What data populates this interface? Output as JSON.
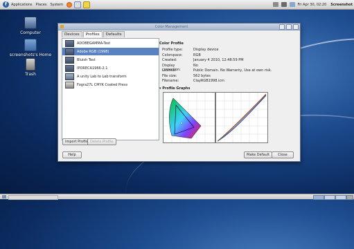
{
  "panel": {
    "menus": [
      "Applications",
      "Places",
      "System"
    ],
    "clock": "Fri Apr 30, 02:20",
    "screenshot_label": "Screenshot"
  },
  "desktop_icons": [
    {
      "label": "Computer",
      "icon": "computer-icon"
    },
    {
      "label": "screenshots's Home",
      "icon": "home-folder-icon"
    },
    {
      "label": "Trash",
      "icon": "trash-icon"
    }
  ],
  "window": {
    "title": "Color Management",
    "tabs": [
      "Devices",
      "Profiles",
      "Defaults"
    ],
    "active_tab": "Profiles",
    "profiles": [
      {
        "name": "ADOBEGAMMA-Test",
        "icon": "display-profile-icon"
      },
      {
        "name": "Adobe RGB (1998)",
        "icon": "display-profile-icon",
        "selected": true
      },
      {
        "name": "Bluish Test",
        "icon": "display-profile-icon"
      },
      {
        "name": "IPORECA1966-2.1",
        "icon": "display-profile-icon"
      },
      {
        "name": "A unity Lab to Lab transform",
        "icon": "lab-profile-icon"
      },
      {
        "name": "Fogra27L CMYK Coated Press",
        "icon": "printer-profile-icon"
      }
    ],
    "details": {
      "header": "Color Profile",
      "rows": [
        {
          "key": "Profile type:",
          "value": "Display device"
        },
        {
          "key": "Colorspace:",
          "value": "RGB"
        },
        {
          "key": "Created:",
          "value": "January 4 2010, 12:48:59 PM"
        },
        {
          "key": "Display correction:",
          "value": "No"
        },
        {
          "key": "License:",
          "value": "Public Domain. No Warranty, Use at own risk."
        },
        {
          "key": "File size:",
          "value": "562 bytes"
        },
        {
          "key": "Filename:",
          "value": "ClayRGB1998.icm"
        }
      ],
      "graphs_header": "Profile Graphs"
    },
    "buttons": {
      "import": "Import Profile",
      "delete": "Delete Profile",
      "help": "Help",
      "make_default": "Make Default",
      "close": "Close"
    }
  },
  "colors": {
    "selection": "#5a82c0",
    "desktop": "#1d4c8f"
  }
}
